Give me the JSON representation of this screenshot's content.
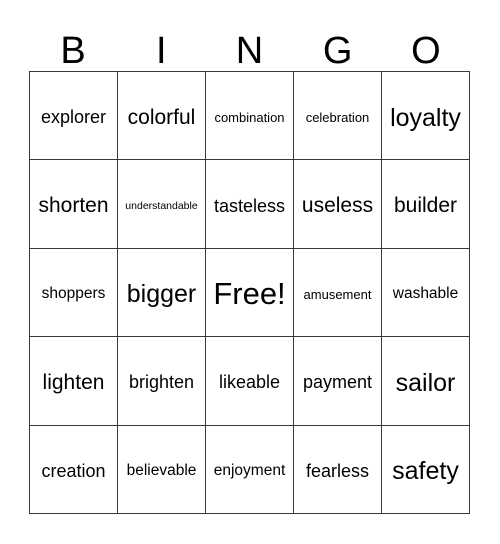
{
  "card": {
    "title": "BINGO",
    "header_letters": [
      "B",
      "I",
      "N",
      "G",
      "O"
    ],
    "colors": {
      "background": "#ffffff",
      "text": "#000000",
      "grid_line": "#3a3a3a"
    },
    "grid": {
      "columns": 5,
      "rows": 5,
      "free_space": "Free!",
      "free_space_position": {
        "row": 3,
        "column": 3
      }
    },
    "rows": [
      [
        {
          "text": "explorer",
          "size": "lg"
        },
        {
          "text": "colorful",
          "size": "xl"
        },
        {
          "text": "combination",
          "size": "sm"
        },
        {
          "text": "celebration",
          "size": "sm"
        },
        {
          "text": "loyalty",
          "size": "xxl"
        }
      ],
      [
        {
          "text": "shorten",
          "size": "xl"
        },
        {
          "text": "understandable",
          "size": "xs"
        },
        {
          "text": "tasteless",
          "size": "lg"
        },
        {
          "text": "useless",
          "size": "xl"
        },
        {
          "text": "builder",
          "size": "xl"
        }
      ],
      [
        {
          "text": "shoppers",
          "size": "md"
        },
        {
          "text": "bigger",
          "size": "xxl"
        },
        {
          "text": "Free!",
          "size": "free"
        },
        {
          "text": "amusement",
          "size": "sm"
        },
        {
          "text": "washable",
          "size": "md"
        }
      ],
      [
        {
          "text": "lighten",
          "size": "xl"
        },
        {
          "text": "brighten",
          "size": "lg"
        },
        {
          "text": "likeable",
          "size": "lg"
        },
        {
          "text": "payment",
          "size": "lg"
        },
        {
          "text": "sailor",
          "size": "xxl"
        }
      ],
      [
        {
          "text": "creation",
          "size": "lg"
        },
        {
          "text": "believable",
          "size": "md"
        },
        {
          "text": "enjoyment",
          "size": "md"
        },
        {
          "text": "fearless",
          "size": "lg"
        },
        {
          "text": "safety",
          "size": "xxl"
        }
      ]
    ]
  }
}
